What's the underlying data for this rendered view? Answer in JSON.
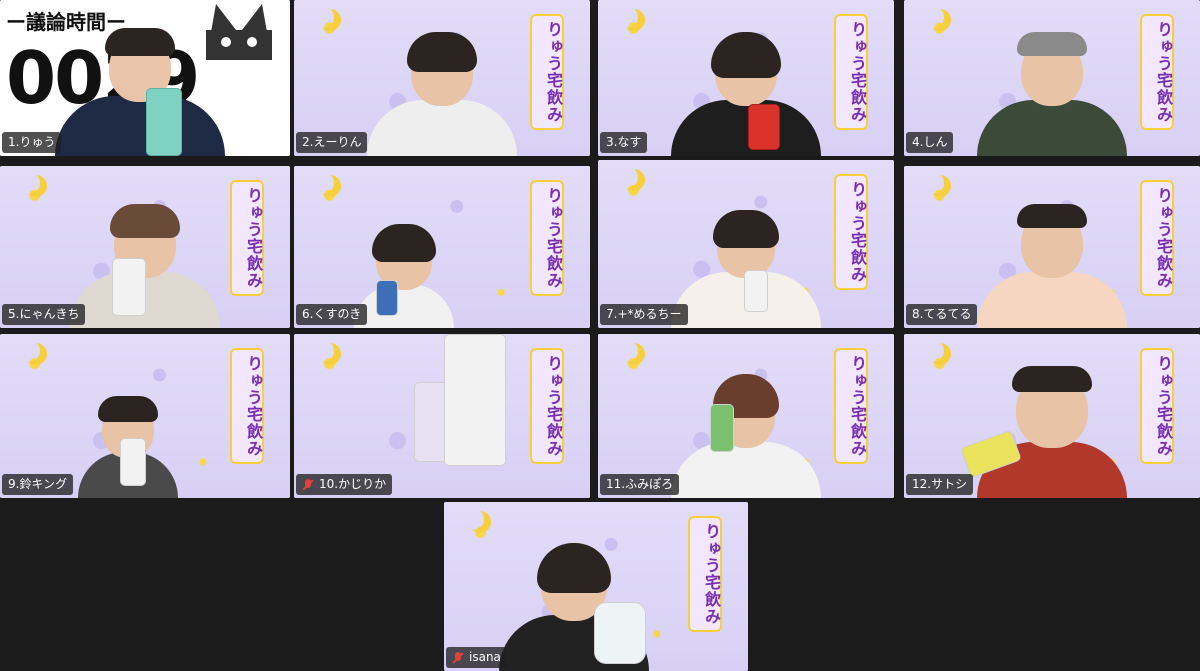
{
  "timer": {
    "label": "ー議論時間ー",
    "value": "0029"
  },
  "banner_text": "りゅう宅飲み",
  "colors": {
    "tile_bg": "#ddd7f6",
    "banner_text": "#7a2fb3",
    "active_border": "#3fd58a",
    "mute": "#e0413a"
  },
  "participants": [
    {
      "name": "1.りゅう",
      "muted": false,
      "active": true
    },
    {
      "name": "2.えーりん",
      "muted": false
    },
    {
      "name": "3.なす",
      "muted": false
    },
    {
      "name": "4.しん",
      "muted": false
    },
    {
      "name": "5.にゃんきち",
      "muted": false
    },
    {
      "name": "6.くすのき",
      "muted": false
    },
    {
      "name": "7.+*めるちー",
      "muted": false
    },
    {
      "name": "8.てるてる",
      "muted": false
    },
    {
      "name": "9.鈴キング",
      "muted": false
    },
    {
      "name": "10.かじりか",
      "muted": true
    },
    {
      "name": "11.ふみぽろ",
      "muted": false
    },
    {
      "name": "12.サトシ",
      "muted": false
    },
    {
      "name": "isana",
      "muted": true
    }
  ]
}
